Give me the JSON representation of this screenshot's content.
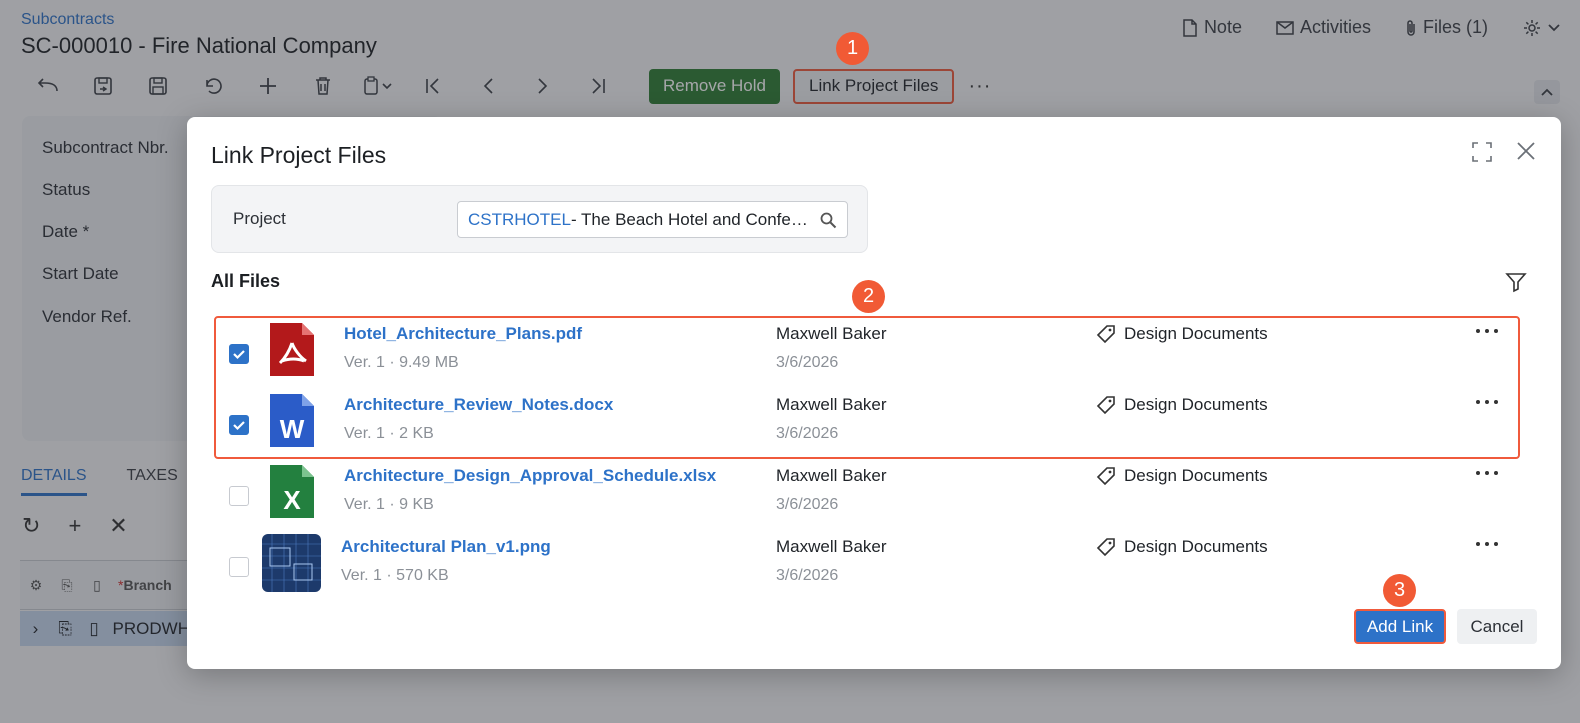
{
  "page": {
    "breadcrumb": "Subcontracts",
    "title": "SC-000010 - Fire National Company",
    "top_actions": [
      {
        "label": "Note",
        "icon": "note-icon"
      },
      {
        "label": "Activities",
        "icon": "mail-icon"
      },
      {
        "label": "Files (1)",
        "icon": "paperclip-icon"
      }
    ],
    "toolbar": {
      "remove_hold": "Remove Hold",
      "link_project_files": "Link Project Files"
    },
    "form_labels": [
      "Subcontract Nbr.",
      "Status",
      "Date *",
      "Start Date",
      "Vendor Ref."
    ],
    "tabs": [
      "DETAILS",
      "TAXES"
    ],
    "grid": {
      "branch_header": "Branch",
      "first_row_value": "PRODWH"
    }
  },
  "callouts": [
    "1",
    "2",
    "3"
  ],
  "modal": {
    "title": "Link Project Files",
    "project_label": "Project",
    "project_code": "CSTRHOTEL",
    "project_desc": " - The Beach Hotel and Conference Center",
    "all_files_label": "All Files",
    "files": [
      {
        "name": "Hotel_Architecture_Plans.pdf",
        "version": "Ver. 1",
        "size": "9.49 MB",
        "owner": "Maxwell Baker",
        "date": "3/6/2026",
        "tag": "Design Documents",
        "type": "pdf",
        "checked": true
      },
      {
        "name": "Architecture_Review_Notes.docx",
        "version": "Ver. 1",
        "size": "2 KB",
        "owner": "Maxwell Baker",
        "date": "3/6/2026",
        "tag": "Design Documents",
        "type": "docx",
        "checked": true
      },
      {
        "name": "Architecture_Design_Approval_Schedule.xlsx",
        "version": "Ver. 1",
        "size": "9 KB",
        "owner": "Maxwell Baker",
        "date": "3/6/2026",
        "tag": "Design Documents",
        "type": "xlsx",
        "checked": false
      },
      {
        "name": "Architectural Plan_v1.png",
        "version": "Ver. 1",
        "size": "570 KB",
        "owner": "Maxwell Baker",
        "date": "3/6/2026",
        "tag": "Design Documents",
        "type": "png",
        "checked": false
      }
    ],
    "add_link": "Add Link",
    "cancel": "Cancel"
  },
  "colors": {
    "accent": "#2d72c8",
    "highlight": "#f05a3c",
    "remove_hold": "#2e7d32"
  }
}
